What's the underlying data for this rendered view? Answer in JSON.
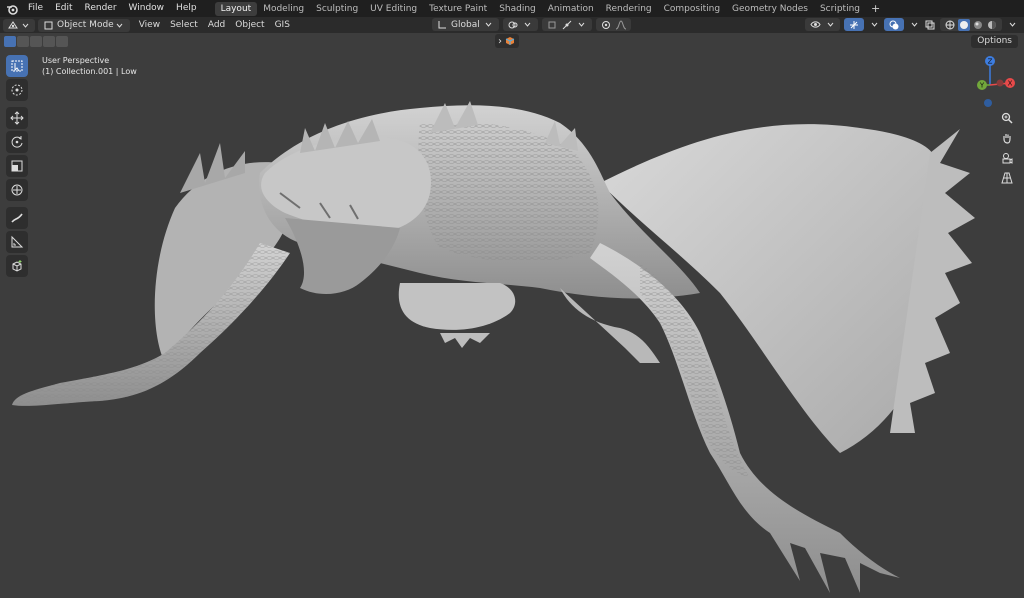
{
  "menu": {
    "items": [
      "File",
      "Edit",
      "Render",
      "Window",
      "Help"
    ]
  },
  "workspaces": {
    "tabs": [
      "Layout",
      "Modeling",
      "Sculpting",
      "UV Editing",
      "Texture Paint",
      "Shading",
      "Animation",
      "Rendering",
      "Compositing",
      "Geometry Nodes",
      "Scripting"
    ],
    "active": "Layout",
    "add_label": "+"
  },
  "header": {
    "mode": "Object Mode",
    "menus": [
      "View",
      "Select",
      "Add",
      "Object",
      "GIS"
    ],
    "transform_orientation": "Global"
  },
  "viewport": {
    "view_name": "User Perspective",
    "collection_info": "(1) Collection.001 | Low",
    "options_label": "Options",
    "collapse_label": "›",
    "background": "#3d3d3d",
    "model_color": "#c8c8c8"
  },
  "gizmo": {
    "z": "Z",
    "y": "Y",
    "x": "X"
  },
  "toolbar": {
    "tools": [
      "select-box-icon",
      "cursor-icon",
      "move-icon",
      "rotate-icon",
      "scale-icon",
      "transform-icon",
      "annotate-icon",
      "measure-icon",
      "add-cube-icon"
    ],
    "active": "select-box-icon"
  },
  "colors": {
    "accent": "#4772b3",
    "x_axis": "#e84a4a",
    "y_axis": "#72a83b",
    "z_axis": "#3d7de0"
  }
}
